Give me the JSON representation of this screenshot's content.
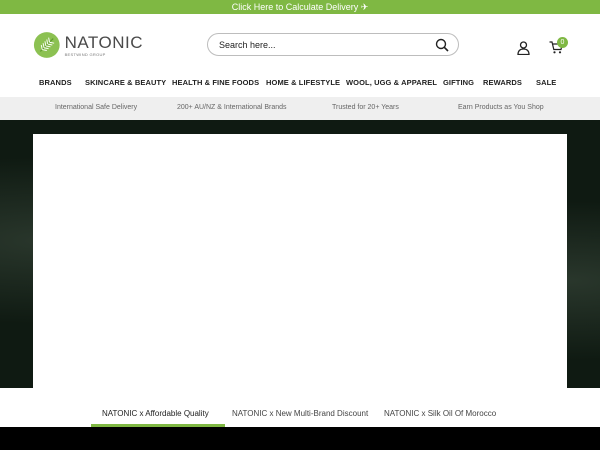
{
  "topbar": {
    "text": "Click Here to Calculate Delivery ✈"
  },
  "brand": {
    "name": "NATONIC",
    "tagline": "BESTWIND GROUP"
  },
  "search": {
    "placeholder": "Search here..."
  },
  "cart": {
    "count": "0"
  },
  "nav": {
    "items": [
      "BRANDS",
      "SKINCARE & BEAUTY",
      "HEALTH & FINE FOODS",
      "HOME & LIFESTYLE",
      "WOOL, UGG & APPAREL",
      "GIFTING",
      "REWARDS",
      "SALE"
    ]
  },
  "trust": {
    "items": [
      "International Safe Delivery",
      "200+ AU/NZ & International Brands",
      "Trusted for 20+ Years",
      "Earn Products as You Shop"
    ]
  },
  "tabs": {
    "items": [
      "NATONIC x Affordable Quality",
      "NATONIC x New Multi-Brand Discount",
      "NATONIC x Silk Oil Of Morocco"
    ],
    "active": "NATONIC x Affordable Quality"
  },
  "colors": {
    "accent": "#7fb843",
    "hero_bg": "#0f1a12"
  },
  "icons": {
    "search": "search-icon",
    "user": "user-icon",
    "cart": "cart-icon",
    "logo": "leaf-logo-icon"
  }
}
